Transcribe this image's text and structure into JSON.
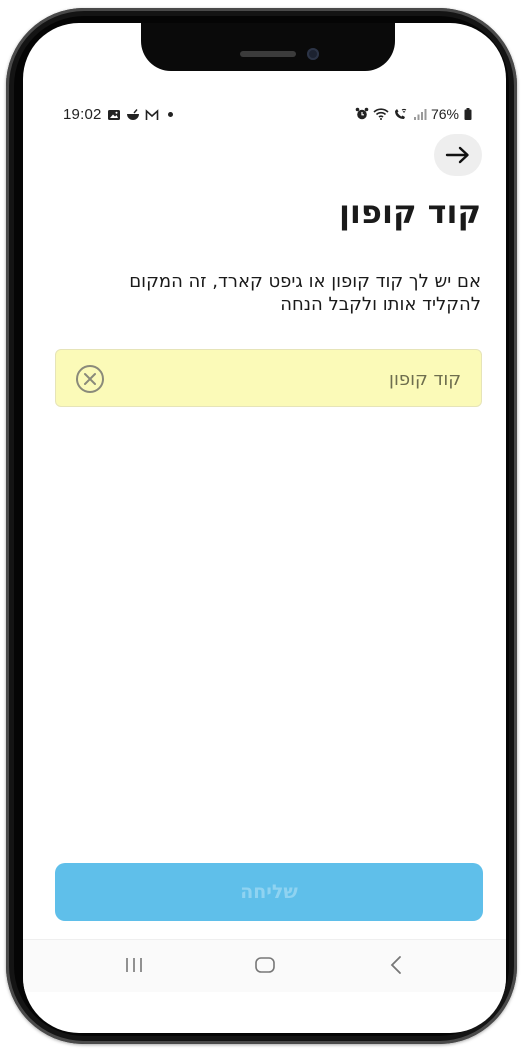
{
  "status_bar": {
    "time": "19:02",
    "battery": "76%",
    "left_icons": [
      "image-icon",
      "bowl-icon",
      "gmail-icon",
      "dot-icon"
    ],
    "right_icons": [
      "alarm-icon",
      "wifi-icon",
      "wifi-calling-icon",
      "signal-icon",
      "battery-icon"
    ]
  },
  "header": {
    "back_icon": "arrow-right-icon"
  },
  "page": {
    "title": "קוד קופון",
    "subtitle": "אם יש לך קוד קופון או גיפט קארד, זה המקום להקליד אותו ולקבל הנחה"
  },
  "coupon_field": {
    "placeholder": "קוד קופון",
    "value": "",
    "clear_icon": "circle-x-icon"
  },
  "submit": {
    "label": "שליחה"
  },
  "nav_bar": {
    "recents_icon": "recents-icon",
    "home_icon": "home-icon",
    "back_icon": "back-chevron-icon"
  },
  "colors": {
    "field_background": "#fbfab8",
    "button_background": "#5fbfea",
    "button_text": "#8fd3f1",
    "back_button_background": "#eeeeee"
  }
}
